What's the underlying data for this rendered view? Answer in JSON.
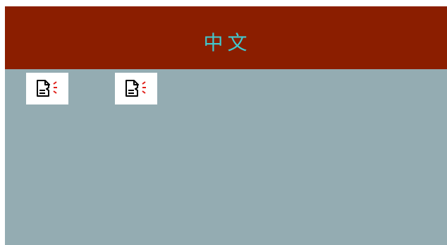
{
  "header": {
    "title": "中文"
  },
  "icons": [
    {
      "name": "speaker-document-icon"
    },
    {
      "name": "speaker-document-icon"
    }
  ],
  "colors": {
    "header_background": "#8b1e00",
    "title_text": "#41c9cf",
    "content_background": "#94acb2",
    "icon_background": "#ffffff",
    "icon_accent": "#e0201a"
  }
}
